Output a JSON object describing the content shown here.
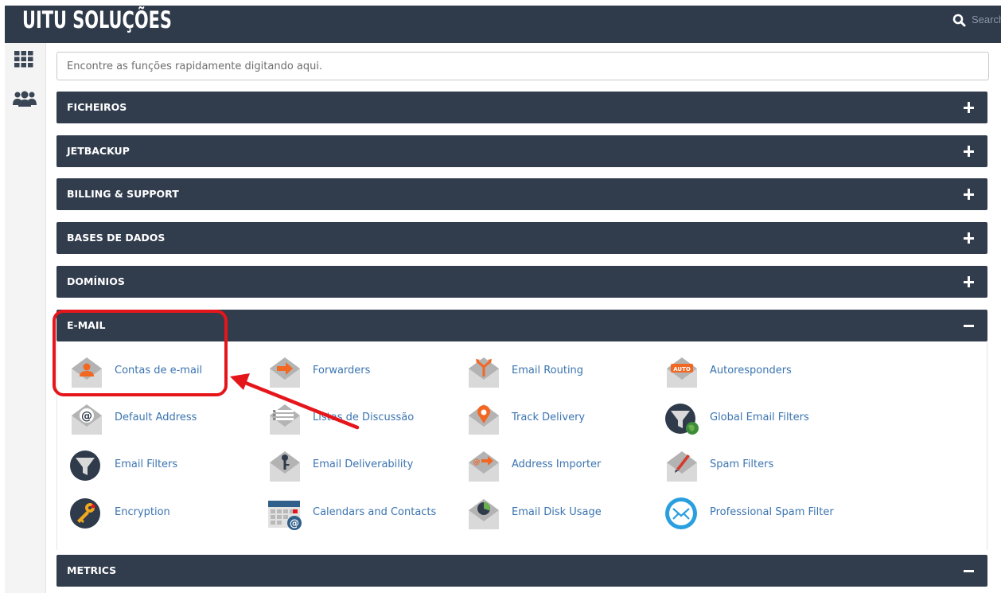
{
  "header": {
    "brand": "UITU SOLUÇÕES",
    "search_label": "Search"
  },
  "sidebar": {
    "items": [
      {
        "icon": "grid-icon"
      },
      {
        "icon": "users-icon"
      }
    ]
  },
  "quickfind": {
    "placeholder": "Encontre as funções rapidamente digitando aqui."
  },
  "panels": [
    {
      "title": "FICHEIROS",
      "state": "collapsed"
    },
    {
      "title": "JETBACKUP",
      "state": "collapsed"
    },
    {
      "title": "BILLING & SUPPORT",
      "state": "collapsed"
    },
    {
      "title": "BASES DE DADOS",
      "state": "collapsed"
    },
    {
      "title": "DOMÍNIOS",
      "state": "collapsed"
    },
    {
      "title": "E-MAIL",
      "state": "expanded"
    },
    {
      "title": "METRICS",
      "state": "expanded"
    }
  ],
  "email_items": [
    {
      "label": "Contas de e-mail",
      "icon": "email-accounts-icon"
    },
    {
      "label": "Forwarders",
      "icon": "forwarders-icon"
    },
    {
      "label": "Email Routing",
      "icon": "email-routing-icon"
    },
    {
      "label": "Autoresponders",
      "icon": "autoresponders-icon",
      "badge": "AUTO"
    },
    {
      "label": "Default Address",
      "icon": "default-address-icon"
    },
    {
      "label": "Listas de Discussão",
      "icon": "mailing-lists-icon"
    },
    {
      "label": "Track Delivery",
      "icon": "track-delivery-icon"
    },
    {
      "label": "Global Email Filters",
      "icon": "global-email-filters-icon"
    },
    {
      "label": "Email Filters",
      "icon": "email-filters-icon"
    },
    {
      "label": "Email Deliverability",
      "icon": "email-deliverability-icon"
    },
    {
      "label": "Address Importer",
      "icon": "address-importer-icon"
    },
    {
      "label": "Spam Filters",
      "icon": "spam-filters-icon"
    },
    {
      "label": "Encryption",
      "icon": "encryption-icon"
    },
    {
      "label": "Calendars and Contacts",
      "icon": "calendars-contacts-icon"
    },
    {
      "label": "Email Disk Usage",
      "icon": "email-disk-usage-icon"
    },
    {
      "label": "Professional Spam Filter",
      "icon": "professional-spam-filter-icon"
    }
  ],
  "colors": {
    "header_bg": "#2f3a4a",
    "panel_bg": "#313c4d",
    "link": "#3b74b0",
    "accent_orange": "#f26722",
    "annotation_red": "#e5161b"
  }
}
